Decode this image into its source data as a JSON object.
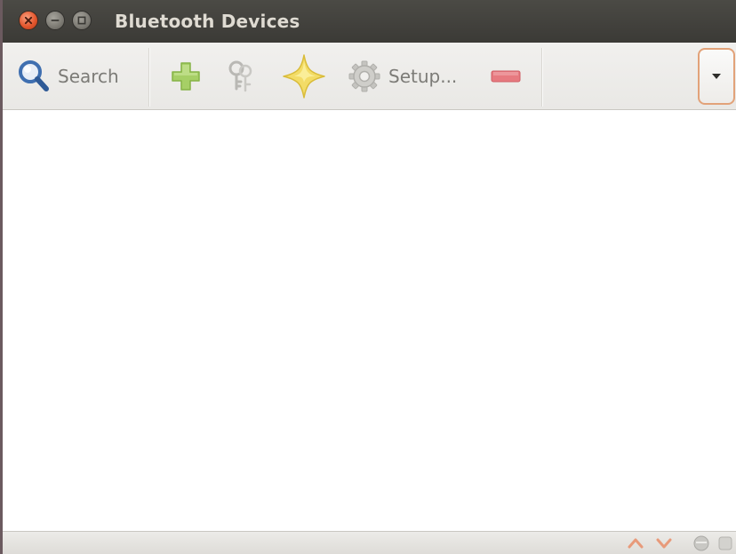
{
  "window": {
    "title": "Bluetooth Devices"
  },
  "titlebar": {
    "close_icon": "close-icon",
    "minimize_icon": "minimize-icon",
    "maximize_icon": "maximize-icon"
  },
  "toolbar": {
    "search": {
      "label": "Search",
      "icon": "search-icon"
    },
    "add": {
      "icon": "plus-icon"
    },
    "keys": {
      "icon": "keys-icon"
    },
    "trust": {
      "icon": "star-icon"
    },
    "setup": {
      "label": "Setup...",
      "icon": "gear-icon"
    },
    "remove": {
      "icon": "minus-icon"
    },
    "more": {
      "icon": "chevron-down-icon"
    }
  },
  "device_list": {
    "items": []
  },
  "statusbar": {
    "icons": [
      "arrow-up-icon",
      "arrow-down-icon",
      "network-icon",
      "power-icon"
    ]
  },
  "colors": {
    "titlebar": "#3f3e3a",
    "close_button": "#e4572e",
    "accent_border": "#e2a279",
    "add_green": "#9cc957",
    "remove_red": "#e06a70",
    "star_yellow": "#f2d95a",
    "search_blue": "#3f6fb0"
  }
}
